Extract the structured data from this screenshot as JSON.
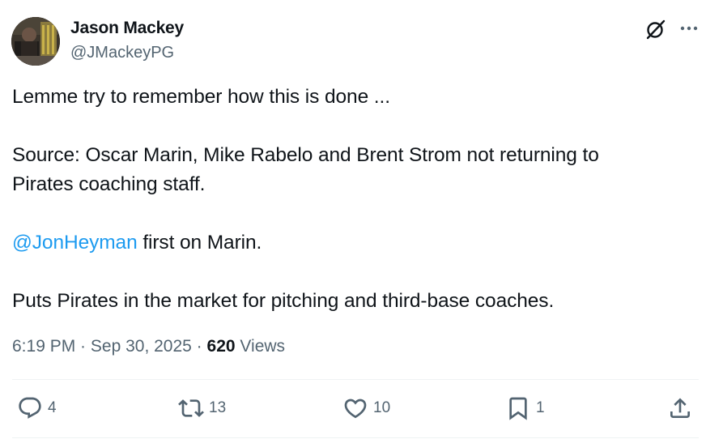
{
  "author": {
    "display_name": "Jason Mackey",
    "handle": "@JMackeyPG"
  },
  "tweet": {
    "line1": "Lemme try to remember how this is done ...",
    "line2a": "Source: Oscar Marin, Mike Rabelo and Brent Strom not returning to",
    "line2b": "Pirates coaching staff.",
    "mention": "@JonHeyman",
    "line3_rest": " first on Marin.",
    "line4": "Puts Pirates in the market for pitching and third-base coaches."
  },
  "meta": {
    "time": "6:19 PM",
    "sep1": " · ",
    "date": "Sep 30, 2025",
    "sep2": " · ",
    "views_count": "620",
    "views_label": " Views"
  },
  "actions": {
    "reply_count": "4",
    "repost_count": "13",
    "like_count": "10",
    "bookmark_count": "1"
  },
  "icons": {
    "grok": "grok-icon",
    "more": "more-icon",
    "reply": "reply-icon",
    "repost": "repost-icon",
    "like": "heart-icon",
    "bookmark": "bookmark-icon",
    "share": "share-icon"
  },
  "colors": {
    "link": "#1d9bf0",
    "secondary_text": "#536471",
    "primary_text": "#0f1419",
    "divider": "#eff3f4"
  }
}
